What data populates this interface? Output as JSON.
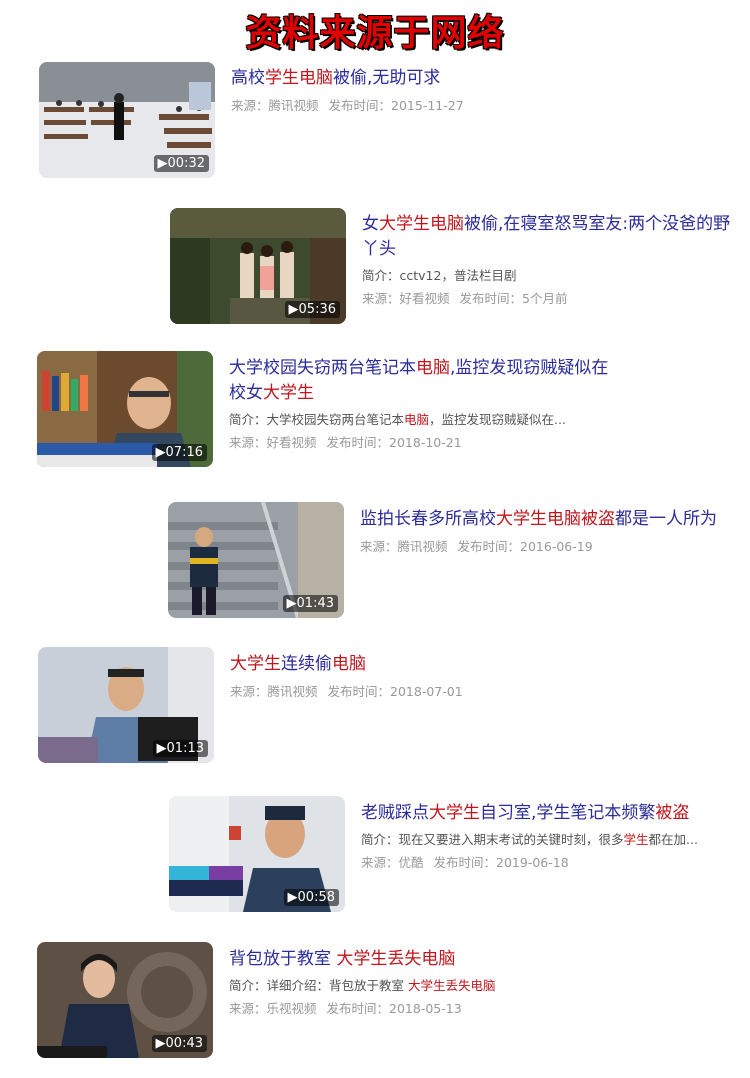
{
  "banner": "资料来源于网络",
  "items": [
    {
      "title_parts": [
        {
          "t": "高校"
        },
        {
          "t": "学生电脑",
          "hl": true
        },
        {
          "t": "被偷,无助可求"
        }
      ],
      "desc_parts": [],
      "source": "来源：腾讯视频",
      "published": "发布时间：2015-11-27",
      "duration": "▶00:32",
      "thumb_icon": "library-scene-thumbnail-icon"
    },
    {
      "title_parts": [
        {
          "t": "女"
        },
        {
          "t": "大学生电脑",
          "hl": true
        },
        {
          "t": "被偷,在寝室怒骂室友:两个没爸的野丫头"
        }
      ],
      "desc_parts": [
        {
          "t": "简介：cctv12，普法栏目剧"
        }
      ],
      "source": "来源：好看视频",
      "published": "发布时间：5个月前",
      "duration": "▶05:36",
      "thumb_icon": "dormitory-scene-thumbnail-icon"
    },
    {
      "title_parts": [
        {
          "t": "大学校园失窃两台笔记本"
        },
        {
          "t": "电脑",
          "hl": true
        },
        {
          "t": ",监控发现窃贼疑似在校女"
        },
        {
          "t": "大学生",
          "hl": true
        }
      ],
      "desc_parts": [
        {
          "t": "简介：大学校园失窃两台笔记本"
        },
        {
          "t": "电脑",
          "hl": true
        },
        {
          "t": "，监控发现窃贼疑似在..."
        }
      ],
      "source": "来源：好看视频",
      "published": "发布时间：2018-10-21",
      "duration": "▶07:16",
      "thumb_icon": "police-interview-thumbnail-icon"
    },
    {
      "title_parts": [
        {
          "t": "监拍长春多所高校"
        },
        {
          "t": "大学生电脑被盗",
          "hl": true
        },
        {
          "t": "都是一人所为"
        }
      ],
      "desc_parts": [],
      "source": "来源：腾讯视频",
      "published": "发布时间：2016-06-19",
      "duration": "▶01:43",
      "thumb_icon": "stairway-cctv-thumbnail-icon"
    },
    {
      "title_parts": [
        {
          "t": "大学生",
          "hl": true
        },
        {
          "t": "连续偷"
        },
        {
          "t": "电脑",
          "hl": true
        }
      ],
      "desc_parts": [],
      "source": "来源：腾讯视频",
      "published": "发布时间：2018-07-01",
      "duration": "▶01:13",
      "thumb_icon": "officer-at-computer-thumbnail-icon"
    },
    {
      "title_parts": [
        {
          "t": "老贼踩点"
        },
        {
          "t": "大学生",
          "hl": true
        },
        {
          "t": "自习室,学生笔记本频繁"
        },
        {
          "t": "被盗",
          "hl": true
        }
      ],
      "desc_parts": [
        {
          "t": "简介：现在又要进入期末考试的关键时刻，很多"
        },
        {
          "t": "学生",
          "hl": true
        },
        {
          "t": "都在加..."
        }
      ],
      "source": "来源：优酷",
      "published": "发布时间：2019-06-18",
      "duration": "▶00:58",
      "thumb_icon": "police-officer-thumbnail-icon"
    },
    {
      "title_parts": [
        {
          "t": "背包放于教室 "
        },
        {
          "t": "大学生丢失电脑",
          "hl": true
        }
      ],
      "desc_parts": [
        {
          "t": "简介：详细介绍：背包放于教室 "
        },
        {
          "t": "大学生丢失",
          "hl": true
        },
        {
          "t": "电脑",
          "hl": true
        }
      ],
      "source": "来源：乐视视频",
      "published": "发布时间：2018-05-13",
      "duration": "▶00:43",
      "thumb_icon": "news-anchor-thumbnail-icon"
    }
  ]
}
